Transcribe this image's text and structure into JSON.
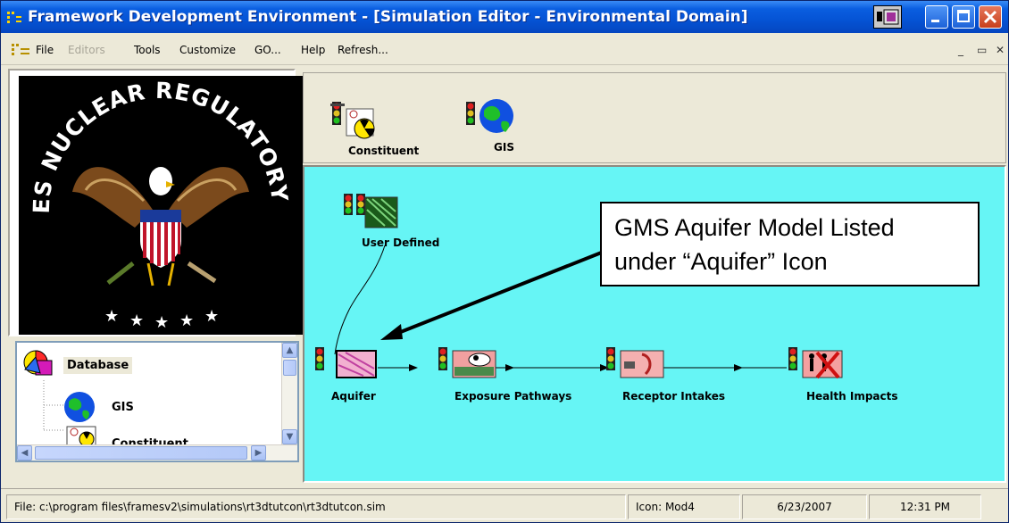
{
  "window": {
    "title": "Framework Development Environment - [Simulation Editor - Environmental Domain]"
  },
  "menu": {
    "items": [
      "File",
      "Editors",
      "Tools",
      "Customize",
      "GO...",
      "Help",
      "Refresh..."
    ],
    "disabled": [
      "Editors"
    ]
  },
  "logo": {
    "seal_text": "UNITED STATES NUCLEAR REGULATORY COMMISSION"
  },
  "tree": {
    "items": [
      {
        "label": "Database",
        "icon": "database-icon",
        "selected": true
      },
      {
        "label": "GIS",
        "icon": "globe-icon"
      },
      {
        "label": "Constituent",
        "icon": "constituent-icon"
      }
    ]
  },
  "palette": {
    "items": [
      {
        "label": "Constituent",
        "icon": "constituent-icon"
      },
      {
        "label": "GIS",
        "icon": "globe-icon"
      }
    ]
  },
  "canvas": {
    "nodes": [
      {
        "label": "User Defined",
        "icon": "user-defined-icon"
      },
      {
        "label": "Aquifer",
        "icon": "aquifer-icon"
      },
      {
        "label": "Exposure Pathways",
        "icon": "exposure-pathways-icon"
      },
      {
        "label": "Receptor Intakes",
        "icon": "receptor-intakes-icon"
      },
      {
        "label": "Health Impacts",
        "icon": "health-impacts-icon"
      }
    ],
    "callout": {
      "line1": "GMS Aquifer Model Listed",
      "line2": "under “Aquifer” Icon"
    },
    "background_color": "#66f5f5"
  },
  "status": {
    "file": "File: c:\\program files\\framesv2\\simulations\\rt3dtutcon\\rt3dtutcon.sim",
    "icon": "Icon: Mod4",
    "date": "6/23/2007",
    "time": "12:31 PM"
  }
}
